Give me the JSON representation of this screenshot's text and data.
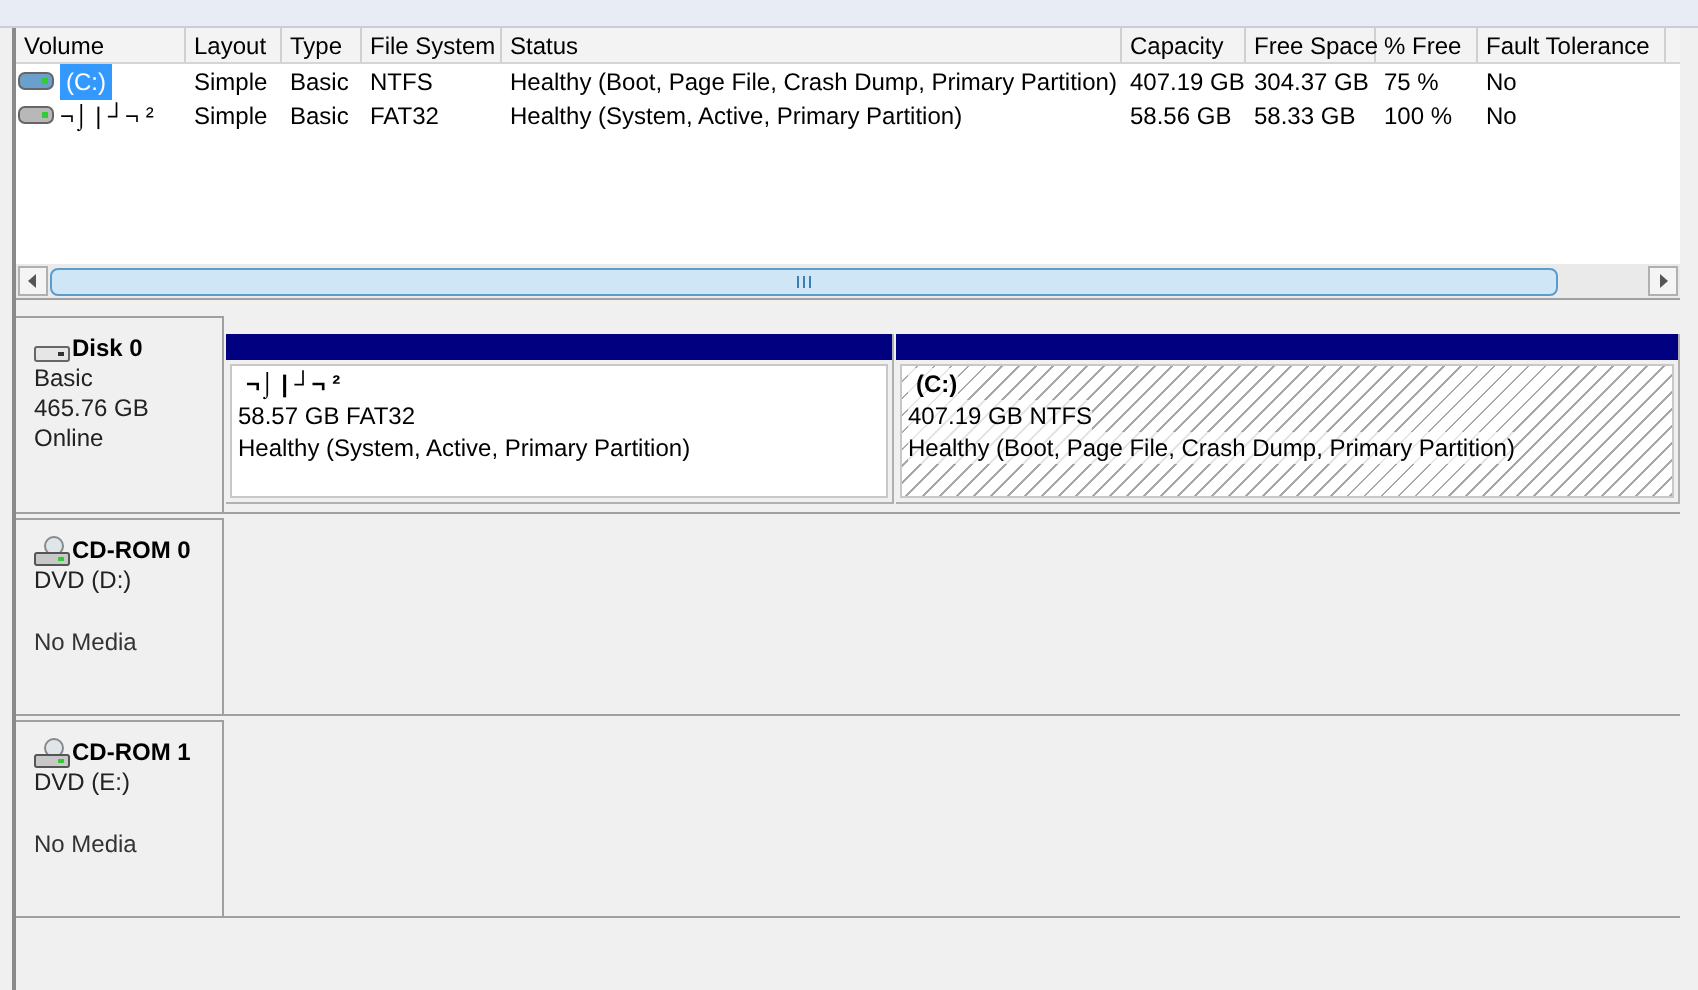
{
  "volume_list": {
    "columns": [
      "Volume",
      "Layout",
      "Type",
      "File System",
      "Status",
      "Capacity",
      "Free Space",
      "% Free",
      "Fault Tolerance"
    ],
    "rows": [
      {
        "selected": true,
        "cells": [
          "(C:)",
          "Simple",
          "Basic",
          "NTFS",
          "Healthy (Boot, Page File, Crash Dump, Primary Partition)",
          "407.19 GB",
          "304.37 GB",
          "75 %",
          "No"
        ]
      },
      {
        "selected": false,
        "cells": [
          "¬⌡ | ┘¬ ²",
          "Simple",
          "Basic",
          "FAT32",
          "Healthy (System, Active, Primary Partition)",
          "58.56 GB",
          "58.33 GB",
          "100 %",
          "No"
        ]
      }
    ]
  },
  "disks": [
    {
      "kind": "disk",
      "name": "Disk 0",
      "lines": [
        "Basic",
        "465.76 GB",
        "Online"
      ],
      "partitions": [
        {
          "label": "¬⌡ | ┘¬ ²",
          "size": "58.57 GB FAT32",
          "status": "Healthy (System, Active, Primary Partition)",
          "selected": false
        },
        {
          "label": "(C:)",
          "size": "407.19 GB NTFS",
          "status": "Healthy (Boot, Page File, Crash Dump, Primary Partition)",
          "selected": true
        }
      ]
    },
    {
      "kind": "cdrom",
      "name": "CD-ROM 0",
      "lines": [
        "DVD (D:)",
        "No Media"
      ]
    },
    {
      "kind": "cdrom",
      "name": "CD-ROM 1",
      "lines": [
        "DVD (E:)",
        "No Media"
      ]
    }
  ]
}
